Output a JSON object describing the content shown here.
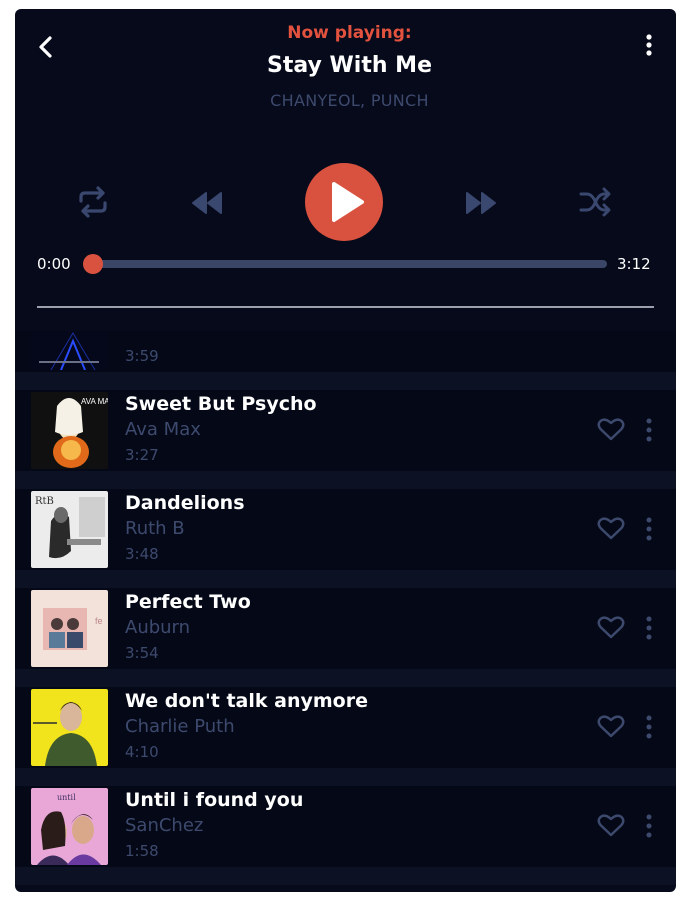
{
  "header": {
    "now_label": "Now playing:",
    "title": "Stay With Me",
    "artist": "CHANYEOL, PUNCH",
    "back_icon": "chevron-left-icon",
    "menu_icon": "more-vertical-icon"
  },
  "controls": {
    "repeat_icon": "repeat-icon",
    "rewind_icon": "rewind-icon",
    "play_icon": "play-icon",
    "forward_icon": "fast-forward-icon",
    "shuffle_icon": "shuffle-icon"
  },
  "progress": {
    "current": "0:00",
    "total": "3:12",
    "fraction": 0.0
  },
  "playlist": [
    {
      "title": "",
      "artist": "",
      "duration": "3:59",
      "partial": true
    },
    {
      "title": "Sweet But Psycho",
      "artist": "Ava Max",
      "duration": "3:27"
    },
    {
      "title": "Dandelions",
      "artist": "Ruth B",
      "duration": "3:48"
    },
    {
      "title": "Perfect Two",
      "artist": "Auburn",
      "duration": "3:54"
    },
    {
      "title": "We don't talk anymore",
      "artist": "Charlie Puth",
      "duration": "4:10"
    },
    {
      "title": "Until i found you",
      "artist": "SanChez",
      "duration": "1:58"
    }
  ],
  "colors": {
    "background": "#060a1a",
    "accent": "#e2523f",
    "muted": "#3d4a6e",
    "text": "#ffffff"
  }
}
